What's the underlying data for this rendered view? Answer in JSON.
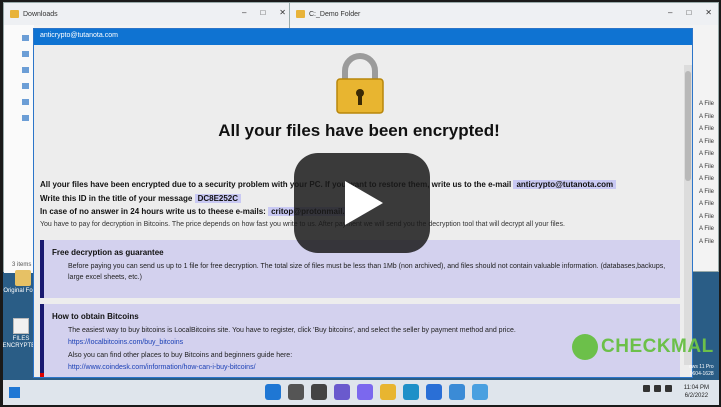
{
  "explorer_left": {
    "title": "Downloads",
    "status": "3 items"
  },
  "explorer_right": {
    "title": "C:_Demo Folder",
    "file_type_label": "A File",
    "file_rows": 12
  },
  "desktop_icons": [
    {
      "label": "Original Folder"
    },
    {
      "label": "FILES ENCRYPTED"
    }
  ],
  "note": {
    "window_title": "anticrypto@tutanota.com",
    "heading": "All your files have been encrypted!",
    "line1_prefix": "All your files have been encrypted due to a security problem with your PC. If you want to restore them, write us to the e-mail",
    "line1_email": "anticrypto@tutanota.com",
    "line2_prefix": "Write this ID in the title of your message",
    "line2_id": "DC8E252C",
    "line3_prefix": "In case of no answer in 24 hours write us to theese e-mails:",
    "line3_email": "critop@protonmail.com",
    "line4": "You have to pay for decryption in Bitcoins. The price depends on how fast you write to us. After payment we will send you the decryption tool that will decrypt all your files.",
    "panel1": {
      "heading": "Free decryption as guarantee",
      "text": "Before paying you can send us up to 1 file for free decryption. The total size of files must be less than 1Mb (non archived), and files should not contain valuable information. (databases,backups, large excel sheets, etc.)"
    },
    "panel2": {
      "heading": "How to obtain Bitcoins",
      "text1": "The easiest way to buy bitcoins is LocalBitcoins site. You have to register, click 'Buy bitcoins', and select the seller by payment method and price.",
      "link1": "https://localbitcoins.com/buy_bitcoins",
      "text2": "Also you can find other places to buy Bitcoins and beginners guide here:",
      "link2": "http://www.coindesk.com/information/how-can-i-buy-bitcoins/"
    }
  },
  "watermark": "CHECKMAL",
  "edition": {
    "line1": "ows 11 Pro",
    "line2": "0604-1628"
  },
  "clock": {
    "time": "11:04 PM",
    "date": "6/2/2022"
  },
  "colors": {
    "titlebar": "#0f73d2",
    "panel": "#d3d1ee",
    "panel_border": "#191970",
    "watermark": "#6cc04a"
  }
}
